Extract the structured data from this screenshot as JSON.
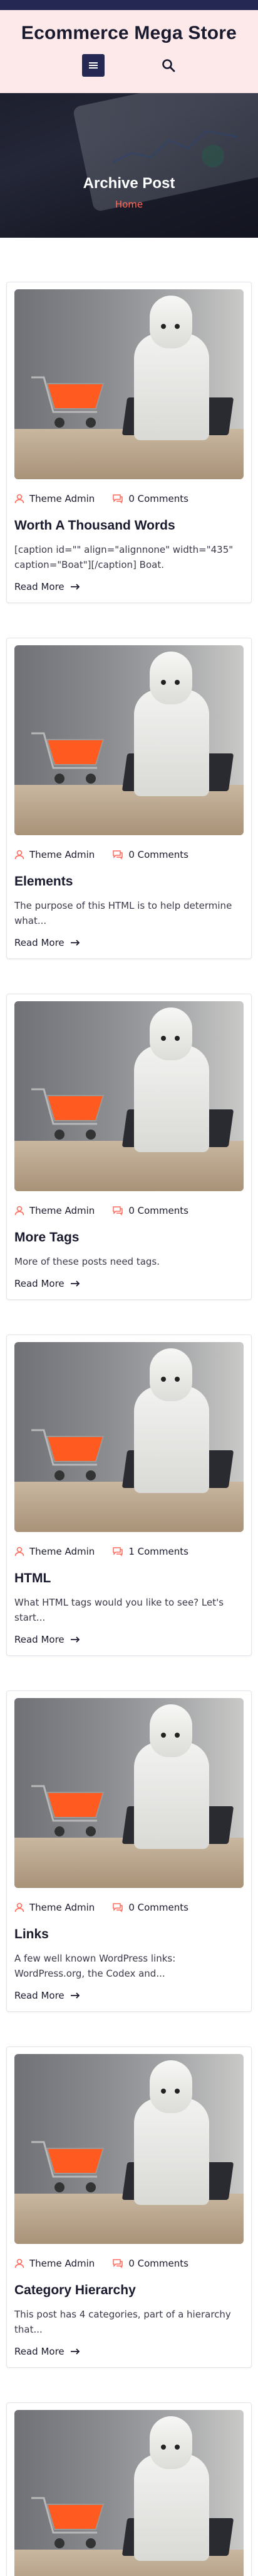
{
  "site": {
    "title": "Ecommerce Mega Store"
  },
  "header": {
    "menu_icon": "menu-icon",
    "search_icon": "search-icon"
  },
  "hero": {
    "title": "Archive Post",
    "breadcrumb": "Home"
  },
  "colors": {
    "accent": "#ff6a5c",
    "navy": "#262854",
    "header_bg": "#fde9ea"
  },
  "posts": [
    {
      "author": "Theme Admin",
      "comments": "0 Comments",
      "title": "Worth A Thousand Words",
      "excerpt": "[caption id=\"\" align=\"alignnone\" width=\"435\" caption=\"Boat\"][/caption] Boat.",
      "read_more": "Read More"
    },
    {
      "author": "Theme Admin",
      "comments": "0 Comments",
      "title": "Elements",
      "excerpt": "The purpose of this HTML is to help determine what...",
      "read_more": "Read More"
    },
    {
      "author": "Theme Admin",
      "comments": "0 Comments",
      "title": "More Tags",
      "excerpt": "More of these posts need tags.",
      "read_more": "Read More"
    },
    {
      "author": "Theme Admin",
      "comments": "1 Comments",
      "title": "HTML",
      "excerpt": "What HTML tags would you like to see? Let's start...",
      "read_more": "Read More"
    },
    {
      "author": "Theme Admin",
      "comments": "0 Comments",
      "title": "Links",
      "excerpt": "A few well known WordPress links: WordPress.org, the Codex and...",
      "read_more": "Read More"
    },
    {
      "author": "Theme Admin",
      "comments": "0 Comments",
      "title": "Category Hierarchy",
      "excerpt": "This post has 4 categories, part of a hierarchy that...",
      "read_more": "Read More"
    },
    {
      "author": "",
      "comments": "",
      "title": "",
      "excerpt": "",
      "read_more": ""
    }
  ]
}
